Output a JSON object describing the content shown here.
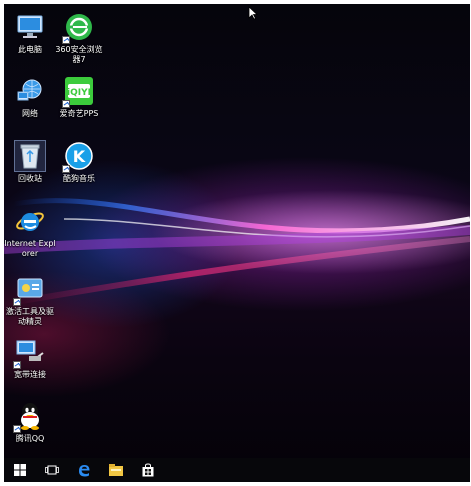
{
  "desktop": {
    "icons": [
      {
        "label": "此电脑",
        "icon": "computer-icon"
      },
      {
        "label": "360安全浏览器7",
        "icon": "browser-360-icon"
      },
      {
        "label": "网络",
        "icon": "network-icon"
      },
      {
        "label": "爱奇艺PPS",
        "icon": "iqiyi-icon"
      },
      {
        "label": "回收站",
        "icon": "recycle-bin-icon"
      },
      {
        "label": "酷狗音乐",
        "icon": "kugou-icon"
      },
      {
        "label": "Internet Explorer",
        "icon": "internet-explorer-icon"
      },
      {
        "label": "激活工具及驱动精灵",
        "icon": "driver-tool-icon"
      },
      {
        "label": "宽带连接",
        "icon": "broadband-icon"
      },
      {
        "label": "腾讯QQ",
        "icon": "qq-icon"
      }
    ]
  },
  "taskbar": {
    "items": [
      "start-icon",
      "task-view-icon",
      "edge-icon",
      "file-explorer-icon",
      "store-icon"
    ]
  },
  "colors": {
    "iqiyi_green": "#3ccb3c",
    "kugou_blue": "#1aa0e8",
    "ie_blue": "#1d8ce0",
    "taskbar": "#08080c"
  }
}
